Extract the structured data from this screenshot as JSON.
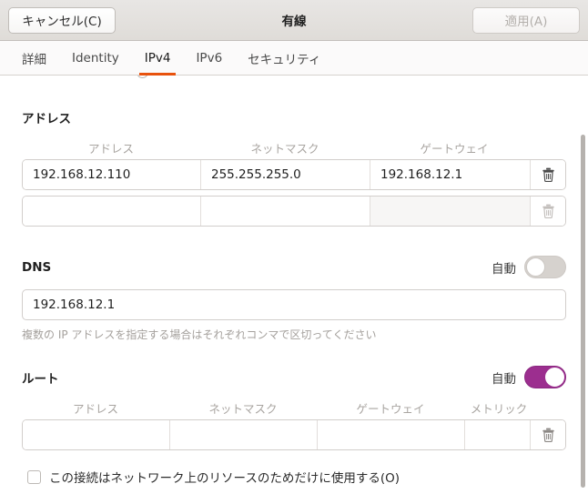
{
  "window": {
    "title": "有線",
    "cancel_label": "キャンセル(C)",
    "apply_label": "適用(A)"
  },
  "tabs": [
    {
      "label": "詳細",
      "active": false
    },
    {
      "label": "Identity",
      "active": false
    },
    {
      "label": "IPv4",
      "active": true
    },
    {
      "label": "IPv6",
      "active": false
    },
    {
      "label": "セキュリティ",
      "active": false
    }
  ],
  "accent_color": "#e8520d",
  "toggle_on_color": "#9c2e8f",
  "addresses": {
    "title": "アドレス",
    "columns": [
      "アドレス",
      "ネットマスク",
      "ゲートウェイ"
    ],
    "rows": [
      {
        "address": "192.168.12.110",
        "netmask": "255.255.255.0",
        "gateway": "192.168.12.1",
        "delete_icon": "trash-icon",
        "delete_enabled": true
      },
      {
        "address": "",
        "netmask": "",
        "gateway": "",
        "delete_icon": "trash-icon",
        "delete_enabled": false
      }
    ]
  },
  "dns": {
    "title": "DNS",
    "auto_label": "自動",
    "auto_on": false,
    "value": "192.168.12.1",
    "hint": "複数の IP アドレスを指定する場合はそれぞれコンマで区切ってください"
  },
  "routes": {
    "title": "ルート",
    "auto_label": "自動",
    "auto_on": true,
    "columns": [
      "アドレス",
      "ネットマスク",
      "ゲートウェイ",
      "メトリック"
    ],
    "rows": [
      {
        "address": "",
        "netmask": "",
        "gateway": "",
        "metric": "",
        "delete_icon": "trash-icon",
        "delete_enabled": true
      }
    ]
  },
  "restrict": {
    "label": "この接続はネットワーク上のリソースのためだけに使用する(O)",
    "checked": false
  }
}
